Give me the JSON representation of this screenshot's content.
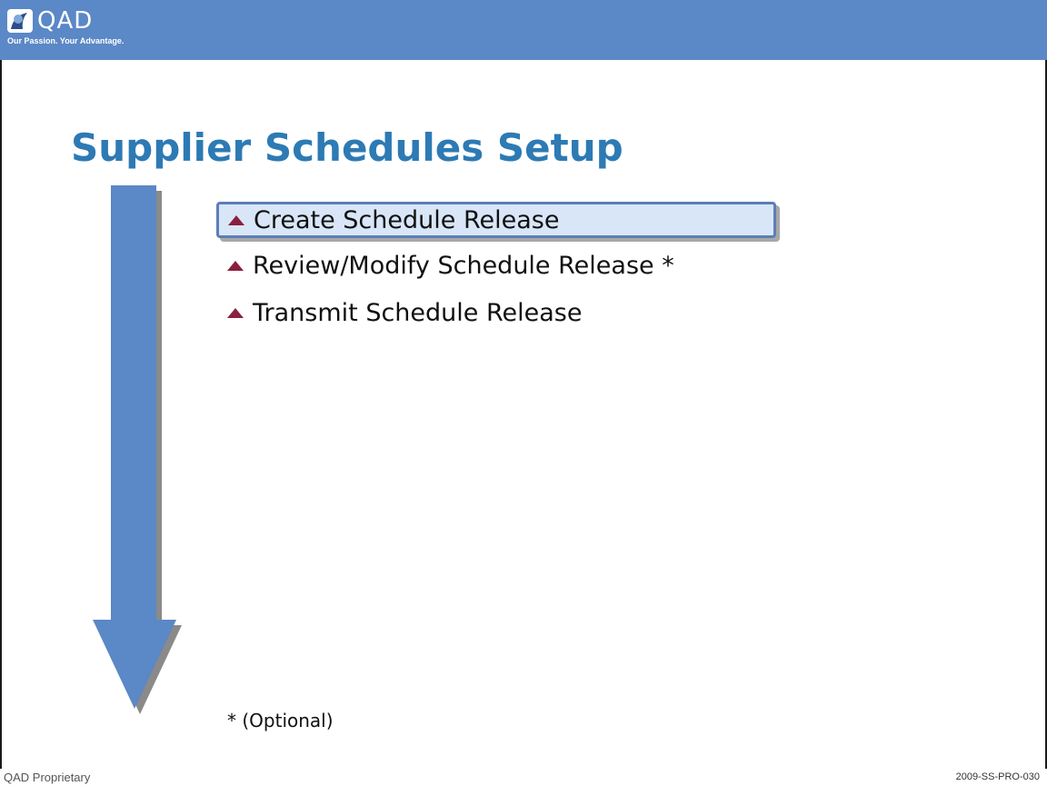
{
  "header": {
    "logo_text": "QAD",
    "tagline": "Our Passion. Your Advantage.",
    "background_color": "#5b88c6"
  },
  "slide": {
    "title": "Supplier Schedules Setup",
    "title_color": "#2d7ab4",
    "steps": [
      {
        "label": "Create Schedule Release",
        "highlighted": true
      },
      {
        "label": "Review/Modify Schedule Release *",
        "highlighted": false
      },
      {
        "label": "Transmit Schedule Release",
        "highlighted": false
      }
    ],
    "optional_note": "* (Optional)",
    "flow_arrow_icon": "down-arrow-icon",
    "bullet_icon": "triangle-up-icon",
    "bullet_color": "#8c1f3f"
  },
  "footer": {
    "left": "QAD Proprietary",
    "right": "2009-SS-PRO-030"
  }
}
